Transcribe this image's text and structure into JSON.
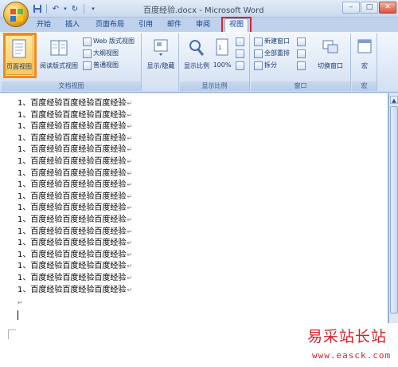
{
  "window": {
    "title": "百度经验.docx - Microsoft Word"
  },
  "window_controls": {
    "minimize": "–",
    "maximize": "□",
    "close": "✕"
  },
  "tabs": [
    "开始",
    "插入",
    "页面布局",
    "引用",
    "邮件",
    "审阅",
    "视图"
  ],
  "active_tab": "视图",
  "ribbon": {
    "doc_views": {
      "label": "文档视图",
      "print_layout": "页面视图",
      "full_screen_reading": "阅读版式视图",
      "web_layout": "Web 版式视图",
      "outline": "大纲视图",
      "draft": "普通视图"
    },
    "show_hide": {
      "label": "显示/隐藏"
    },
    "zoom": {
      "label": "显示比例",
      "zoom_button": "显示比例",
      "percent": "100%"
    },
    "window": {
      "label": "窗口",
      "new_window": "新建窗口",
      "arrange_all": "全部重排",
      "split": "拆分",
      "switch_windows": "切换窗口"
    },
    "macros": {
      "label": "宏",
      "button": "宏"
    }
  },
  "document": {
    "lines": [
      "1、百度经验百度经验百度经验",
      "1、百度经验百度经验百度经验",
      "1、百度经验百度经验百度经验",
      "1、百度经验百度经验百度经验",
      "1、百度经验百度经验百度经验",
      "1、百度经验百度经验百度经验",
      "1、百度经验百度经验百度经验",
      "1、百度经验百度经验百度经验",
      "1、百度经验百度经验百度经验",
      "1、百度经验百度经验百度经验",
      "1、百度经验百度经验百度经验",
      "1、百度经验百度经验百度经验",
      "1、百度经验百度经验百度经验",
      "1、百度经验百度经验百度经验",
      "1、百度经验百度经验百度经验",
      "1、百度经验百度经验百度经验",
      "1、百度经验百度经验百度经验"
    ],
    "paragraph_mark": "↵"
  },
  "watermark": {
    "text": "易采站长站",
    "url": "www.easck.com"
  }
}
